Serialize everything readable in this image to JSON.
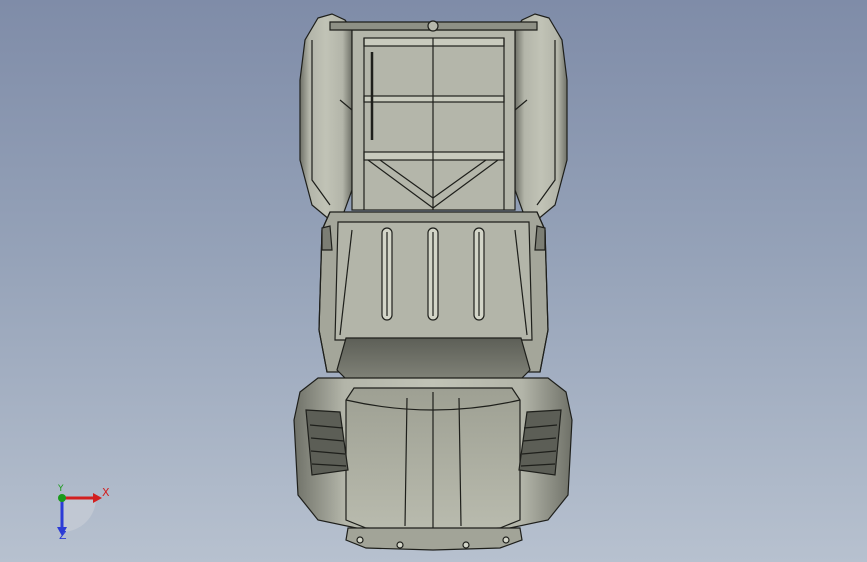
{
  "viewport": {
    "name": "3D model view",
    "background_top": "#7f8ca8",
    "background_bottom": "#b7c1cf"
  },
  "model": {
    "body_color": "#a6a99d",
    "edge_color": "#1e1f1b",
    "view": "top"
  },
  "triad": {
    "x_label": "X",
    "y_label": "Y",
    "z_label": "Z",
    "x_color": "#d21f1f",
    "y_color": "#1a9a1a",
    "z_color": "#2b3bd6"
  }
}
